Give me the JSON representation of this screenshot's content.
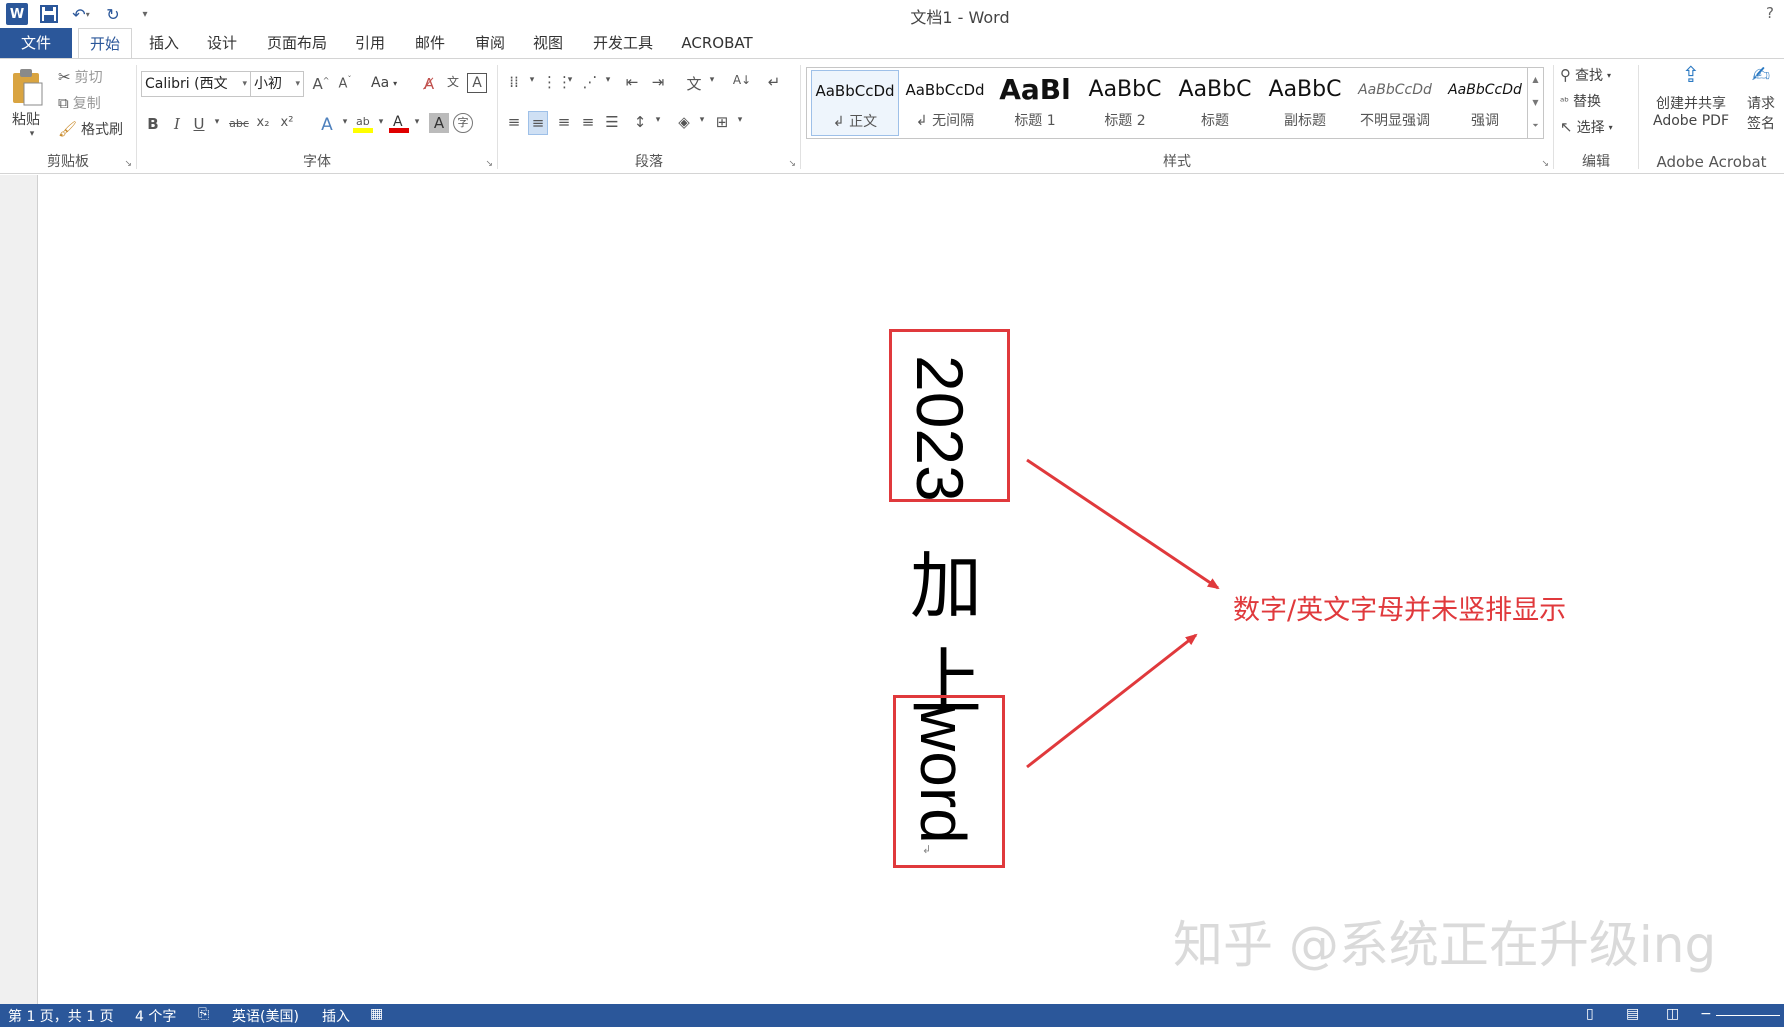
{
  "window": {
    "title": "文档1 - Word",
    "help": "?"
  },
  "quick_access": {
    "icons": [
      "word-logo",
      "save-icon",
      "undo-icon",
      "redo-icon",
      "customize-icon"
    ]
  },
  "tabs": [
    {
      "label": "文件"
    },
    {
      "label": "开始"
    },
    {
      "label": "插入"
    },
    {
      "label": "设计"
    },
    {
      "label": "页面布局"
    },
    {
      "label": "引用"
    },
    {
      "label": "邮件"
    },
    {
      "label": "审阅"
    },
    {
      "label": "视图"
    },
    {
      "label": "开发工具"
    },
    {
      "label": "ACROBAT"
    }
  ],
  "ribbon": {
    "clipboard": {
      "label": "剪贴板",
      "paste": "粘贴",
      "cut": "剪切",
      "copy": "复制",
      "format_painter": "格式刷"
    },
    "font": {
      "label": "字体",
      "font_name": "Calibri (西文",
      "font_size": "小初",
      "change_case": "Aa",
      "bold": "B",
      "italic": "I",
      "underline": "U",
      "strike": "abc",
      "subscript": "x₂",
      "superscript": "x²"
    },
    "paragraph": {
      "label": "段落"
    },
    "styles": {
      "label": "样式",
      "items": [
        {
          "sample": "AaBbCcDd",
          "name": "↲ 正文"
        },
        {
          "sample": "AaBbCcDd",
          "name": "↲ 无间隔"
        },
        {
          "sample": "AaBl",
          "name": "标题 1"
        },
        {
          "sample": "AaBbC",
          "name": "标题 2"
        },
        {
          "sample": "AaBbC",
          "name": "标题"
        },
        {
          "sample": "AaBbC",
          "name": "副标题"
        },
        {
          "sample": "AaBbCcDd",
          "name": "不明显强调"
        },
        {
          "sample": "AaBbCcDd",
          "name": "强调"
        }
      ]
    },
    "editing": {
      "label": "编辑",
      "find": "查找",
      "replace": "替换",
      "select": "选择"
    },
    "acrobat": {
      "label": "Adobe Acrobat",
      "create_line1": "创建并共享",
      "create_line2": "Adobe PDF",
      "request_line1": "请求",
      "request_line2": "签名"
    }
  },
  "document": {
    "number_text": "2023",
    "cjk_1": "加",
    "cjk_2": "上",
    "word_text": "word",
    "annotation": "数字/英文字母并未竖排显示",
    "watermark": "知乎 @系统正在升级ing"
  },
  "status": {
    "page": "第 1 页，共 1 页",
    "words": "4 个字",
    "language": "英语(美国)",
    "mode": "插入"
  },
  "colors": {
    "accent": "#2b579a",
    "annotation_red": "#e0393c"
  }
}
